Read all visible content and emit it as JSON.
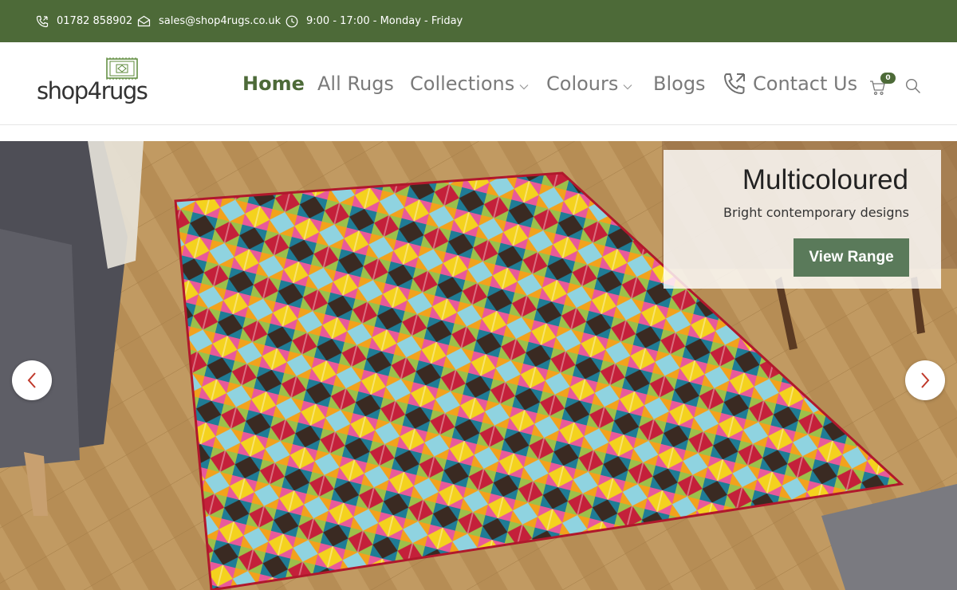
{
  "topbar": {
    "phone": "01782 858902",
    "email": "sales@shop4rugs.co.uk",
    "hours": "9:00 - 17:00 - Monday - Friday",
    "bg_color": "#4d6a38"
  },
  "logo": {
    "text": "shop4rugs"
  },
  "nav": {
    "home": "Home",
    "all_rugs": "All Rugs",
    "collections": "Collections",
    "colours": "Colours",
    "blogs": "Blogs",
    "contact": "Contact Us",
    "active": "Home",
    "accent": "#4d6a38"
  },
  "cart": {
    "count": "0"
  },
  "hero": {
    "title": "Multicoloured",
    "subtitle": "Bright contemporary designs",
    "button": "View Range"
  }
}
